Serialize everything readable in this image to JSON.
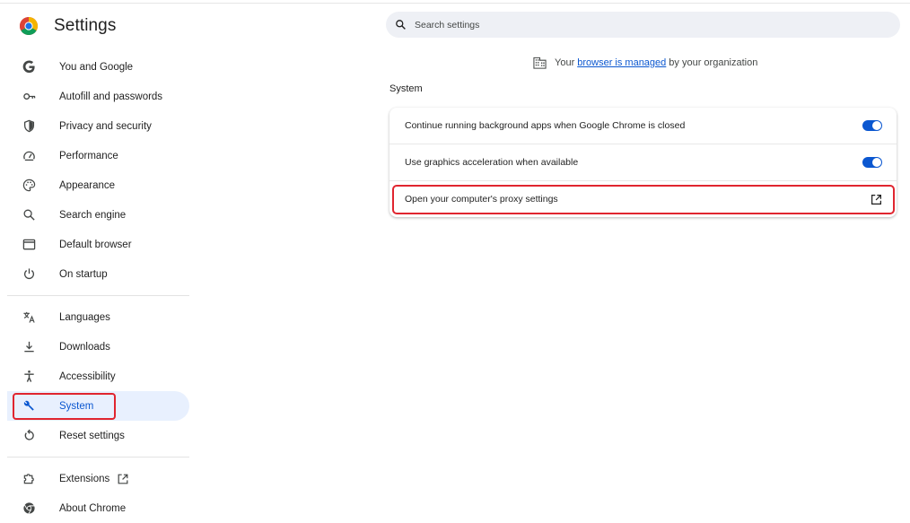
{
  "app": {
    "title": "Settings"
  },
  "search": {
    "placeholder": "Search settings"
  },
  "sidebar": {
    "items": [
      {
        "label": "You and Google",
        "icon": "google-g-icon"
      },
      {
        "label": "Autofill and passwords",
        "icon": "key-icon"
      },
      {
        "label": "Privacy and security",
        "icon": "shield-icon"
      },
      {
        "label": "Performance",
        "icon": "speedometer-icon"
      },
      {
        "label": "Appearance",
        "icon": "palette-icon"
      },
      {
        "label": "Search engine",
        "icon": "search-icon"
      },
      {
        "label": "Default browser",
        "icon": "browser-window-icon"
      },
      {
        "label": "On startup",
        "icon": "power-icon"
      },
      {
        "label": "Languages",
        "icon": "translate-icon"
      },
      {
        "label": "Downloads",
        "icon": "download-icon"
      },
      {
        "label": "Accessibility",
        "icon": "accessibility-icon"
      },
      {
        "label": "System",
        "icon": "wrench-icon",
        "active": true
      },
      {
        "label": "Reset settings",
        "icon": "reset-icon"
      },
      {
        "label": "Extensions",
        "icon": "puzzle-icon"
      },
      {
        "label": "About Chrome",
        "icon": "chrome-icon"
      }
    ]
  },
  "managed": {
    "prefix": "Your",
    "link": "browser is managed",
    "suffix": "by your organization"
  },
  "system": {
    "title": "System",
    "rows": [
      {
        "label": "Continue running background apps when Google Chrome is closed",
        "control": "toggle",
        "on": true
      },
      {
        "label": "Use graphics acceleration when available",
        "control": "toggle",
        "on": true
      },
      {
        "label": "Open your computer's proxy settings",
        "control": "open-in-new-icon"
      }
    ]
  },
  "colors": {
    "accent": "#0b57d0",
    "active_nav_bg": "#e8f0fe",
    "highlight": "#e0252f",
    "search_bg": "#eef0f5"
  }
}
